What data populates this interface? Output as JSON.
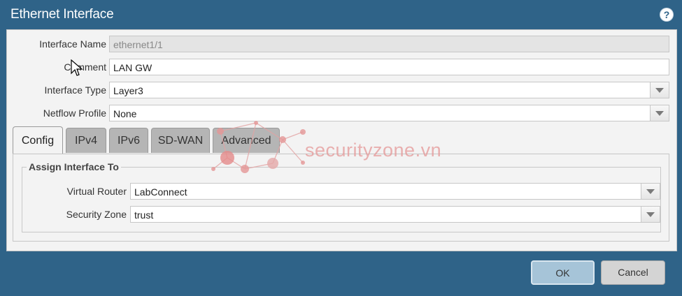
{
  "dialog": {
    "title": "Ethernet Interface",
    "help_icon": "help-icon"
  },
  "fields": {
    "interface_name": {
      "label": "Interface Name",
      "value": "ethernet1/1"
    },
    "comment": {
      "label": "Comment",
      "value": "LAN GW"
    },
    "interface_type": {
      "label": "Interface Type",
      "value": "Layer3"
    },
    "netflow_profile": {
      "label": "Netflow Profile",
      "value": "None"
    }
  },
  "tabs": [
    {
      "label": "Config",
      "active": true
    },
    {
      "label": "IPv4",
      "active": false
    },
    {
      "label": "IPv6",
      "active": false
    },
    {
      "label": "SD-WAN",
      "active": false
    },
    {
      "label": "Advanced",
      "active": false
    }
  ],
  "assign": {
    "legend": "Assign Interface To",
    "virtual_router": {
      "label": "Virtual Router",
      "value": "LabConnect"
    },
    "security_zone": {
      "label": "Security Zone",
      "value": "trust"
    }
  },
  "buttons": {
    "ok": "OK",
    "cancel": "Cancel"
  },
  "watermark": {
    "text": "securityzone.vn"
  },
  "colors": {
    "frame": "#2f6388",
    "panel": "#f3f3f3",
    "ok_button": "#a6c4d8",
    "tab_inactive": "#b5b5b5",
    "watermark": "#e59797"
  }
}
